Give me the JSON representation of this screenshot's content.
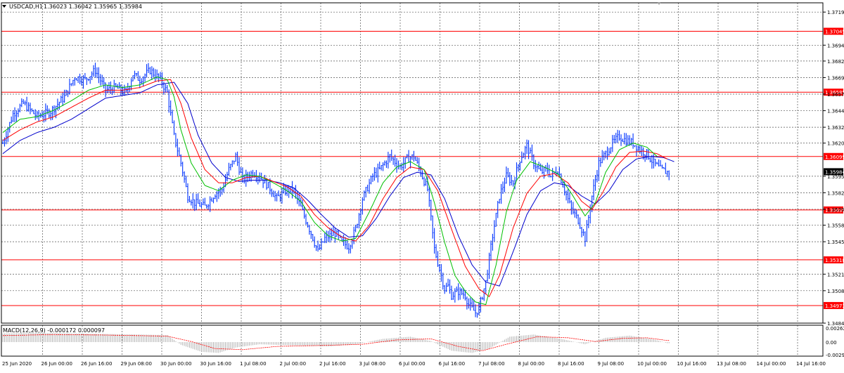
{
  "header": {
    "symbol_label": "USDCAD,H1",
    "ohlc_label": "1.36023 1.36042 1.35965 1.35984"
  },
  "indicator": {
    "label": "MACD(12,26,9) -0.000172 0.000097",
    "ticks": [
      "0.002626",
      "0.00",
      "-0.00298"
    ]
  },
  "colors": {
    "background": "#ffffff",
    "price_line": "#0033ff",
    "ma_fast": "#00c000",
    "ma_mid": "#ff0000",
    "ma_slow": "#0000cc",
    "level_line": "#ff0000",
    "level_label_bg": "#ff0000",
    "current_price_bg": "#000000",
    "grid": "#555555",
    "macd_hist": "#b4b4b4",
    "macd_signal": "#ff0000"
  },
  "chart_data": {
    "type": "line",
    "title": "USDCAD,H1",
    "y_ticks": [
      "1.37190",
      "1.36940",
      "1.36820",
      "1.36695",
      "1.36570",
      "1.36445",
      "1.36320",
      "1.36200",
      "1.35950",
      "1.35825",
      "1.35700",
      "1.35580",
      "1.35455",
      "1.35210",
      "1.35085",
      "1.34840"
    ],
    "ylim": [
      1.3484,
      1.3726
    ],
    "x_tick_labels": [
      "25 Jun 2020",
      "26 Jun 00:00",
      "26 Jun 16:00",
      "29 Jun 08:00",
      "30 Jun 00:00",
      "30 Jun 16:00",
      "1 Jul 08:00",
      "2 Jul 00:00",
      "2 Jul 16:00",
      "3 Jul 08:00",
      "6 Jul 00:00",
      "6 Jul 16:00",
      "7 Jul 08:00",
      "8 Jul 00:00",
      "8 Jul 16:00",
      "9 Jul 08:00",
      "10 Jul 00:00",
      "10 Jul 16:00",
      "13 Jul 08:00",
      "14 Jul 00:00",
      "14 Jul 16:00"
    ],
    "horizontal_levels": [
      "1.37045",
      "1.36585",
      "1.36099",
      "1.35695",
      "1.35318",
      "1.34973"
    ],
    "current_price": "1.35984",
    "price_anchors": [
      [
        0,
        1.362
      ],
      [
        6,
        1.3642
      ],
      [
        12,
        1.365
      ],
      [
        20,
        1.364
      ],
      [
        28,
        1.3644
      ],
      [
        36,
        1.3655
      ],
      [
        42,
        1.367
      ],
      [
        48,
        1.3668
      ],
      [
        54,
        1.3675
      ],
      [
        60,
        1.366
      ],
      [
        66,
        1.3662
      ],
      [
        72,
        1.3658
      ],
      [
        76,
        1.3672
      ],
      [
        80,
        1.3668
      ],
      [
        86,
        1.3675
      ],
      [
        92,
        1.3668
      ],
      [
        96,
        1.3658
      ],
      [
        100,
        1.3625
      ],
      [
        104,
        1.3605
      ],
      [
        108,
        1.358
      ],
      [
        112,
        1.3575
      ],
      [
        118,
        1.3572
      ],
      [
        124,
        1.3582
      ],
      [
        128,
        1.3585
      ],
      [
        132,
        1.36
      ],
      [
        136,
        1.361
      ],
      [
        140,
        1.3592
      ],
      [
        146,
        1.3598
      ],
      [
        150,
        1.3595
      ],
      [
        156,
        1.3586
      ],
      [
        160,
        1.3578
      ],
      [
        166,
        1.3585
      ],
      [
        170,
        1.3584
      ],
      [
        176,
        1.3565
      ],
      [
        180,
        1.3552
      ],
      [
        184,
        1.3538
      ],
      [
        188,
        1.3548
      ],
      [
        194,
        1.3552
      ],
      [
        198,
        1.3545
      ],
      [
        202,
        1.3542
      ],
      [
        206,
        1.3555
      ],
      [
        210,
        1.3578
      ],
      [
        216,
        1.3595
      ],
      [
        220,
        1.36
      ],
      [
        226,
        1.361
      ],
      [
        232,
        1.3602
      ],
      [
        236,
        1.3608
      ],
      [
        240,
        1.361
      ],
      [
        244,
        1.3598
      ],
      [
        248,
        1.3585
      ],
      [
        252,
        1.354
      ],
      [
        256,
        1.352
      ],
      [
        258,
        1.351
      ],
      [
        260,
        1.3512
      ],
      [
        262,
        1.3505
      ],
      [
        266,
        1.3508
      ],
      [
        270,
        1.3505
      ],
      [
        272,
        1.3498
      ],
      [
        276,
        1.3492
      ],
      [
        278,
        1.3495
      ],
      [
        282,
        1.3515
      ],
      [
        286,
        1.355
      ],
      [
        290,
        1.358
      ],
      [
        294,
        1.3595
      ],
      [
        298,
        1.359
      ],
      [
        302,
        1.3608
      ],
      [
        306,
        1.3618
      ],
      [
        310,
        1.3605
      ],
      [
        314,
        1.3598
      ],
      [
        318,
        1.36
      ],
      [
        320,
        1.3595
      ],
      [
        324,
        1.36
      ],
      [
        328,
        1.3585
      ],
      [
        332,
        1.357
      ],
      [
        336,
        1.3562
      ],
      [
        340,
        1.3548
      ],
      [
        344,
        1.358
      ],
      [
        348,
        1.3605
      ],
      [
        352,
        1.3612
      ],
      [
        356,
        1.362
      ],
      [
        360,
        1.3625
      ],
      [
        364,
        1.3622
      ],
      [
        368,
        1.362
      ],
      [
        372,
        1.3615
      ],
      [
        376,
        1.3612
      ],
      [
        380,
        1.3605
      ],
      [
        384,
        1.36
      ],
      [
        388,
        1.3598
      ]
    ],
    "ma_fast_anchors": [
      [
        0,
        1.3628
      ],
      [
        10,
        1.3638
      ],
      [
        20,
        1.364
      ],
      [
        30,
        1.3645
      ],
      [
        40,
        1.3652
      ],
      [
        50,
        1.366
      ],
      [
        60,
        1.3664
      ],
      [
        70,
        1.3662
      ],
      [
        80,
        1.3664
      ],
      [
        90,
        1.367
      ],
      [
        96,
        1.3668
      ],
      [
        100,
        1.3655
      ],
      [
        104,
        1.363
      ],
      [
        110,
        1.3605
      ],
      [
        118,
        1.3588
      ],
      [
        126,
        1.3584
      ],
      [
        134,
        1.3592
      ],
      [
        142,
        1.3596
      ],
      [
        150,
        1.3595
      ],
      [
        158,
        1.359
      ],
      [
        166,
        1.3584
      ],
      [
        174,
        1.3576
      ],
      [
        182,
        1.356
      ],
      [
        190,
        1.355
      ],
      [
        198,
        1.3546
      ],
      [
        206,
        1.3548
      ],
      [
        214,
        1.3568
      ],
      [
        222,
        1.359
      ],
      [
        230,
        1.3602
      ],
      [
        238,
        1.3606
      ],
      [
        246,
        1.36
      ],
      [
        252,
        1.3575
      ],
      [
        258,
        1.3545
      ],
      [
        264,
        1.352
      ],
      [
        270,
        1.3508
      ],
      [
        276,
        1.35
      ],
      [
        282,
        1.3498
      ],
      [
        288,
        1.3528
      ],
      [
        294,
        1.3568
      ],
      [
        300,
        1.3592
      ],
      [
        308,
        1.3606
      ],
      [
        316,
        1.3602
      ],
      [
        324,
        1.3597
      ],
      [
        332,
        1.3582
      ],
      [
        340,
        1.3565
      ],
      [
        346,
        1.3575
      ],
      [
        352,
        1.3598
      ],
      [
        360,
        1.3615
      ],
      [
        368,
        1.362
      ],
      [
        376,
        1.3617
      ],
      [
        382,
        1.361
      ]
    ],
    "ma_mid_anchors": [
      [
        0,
        1.3622
      ],
      [
        10,
        1.363
      ],
      [
        20,
        1.3636
      ],
      [
        30,
        1.364
      ],
      [
        40,
        1.3647
      ],
      [
        50,
        1.3654
      ],
      [
        60,
        1.366
      ],
      [
        70,
        1.366
      ],
      [
        80,
        1.3662
      ],
      [
        90,
        1.3667
      ],
      [
        98,
        1.3668
      ],
      [
        104,
        1.365
      ],
      [
        110,
        1.3624
      ],
      [
        118,
        1.36
      ],
      [
        126,
        1.359
      ],
      [
        134,
        1.359
      ],
      [
        142,
        1.3594
      ],
      [
        150,
        1.3595
      ],
      [
        158,
        1.3591
      ],
      [
        166,
        1.3587
      ],
      [
        174,
        1.358
      ],
      [
        182,
        1.3566
      ],
      [
        190,
        1.3556
      ],
      [
        198,
        1.3549
      ],
      [
        206,
        1.3546
      ],
      [
        214,
        1.3558
      ],
      [
        222,
        1.3578
      ],
      [
        230,
        1.3594
      ],
      [
        238,
        1.3602
      ],
      [
        246,
        1.36
      ],
      [
        254,
        1.3584
      ],
      [
        262,
        1.3555
      ],
      [
        270,
        1.3527
      ],
      [
        278,
        1.351
      ],
      [
        284,
        1.3504
      ],
      [
        290,
        1.352
      ],
      [
        298,
        1.3556
      ],
      [
        306,
        1.3582
      ],
      [
        314,
        1.3595
      ],
      [
        322,
        1.3597
      ],
      [
        330,
        1.359
      ],
      [
        338,
        1.3576
      ],
      [
        344,
        1.357
      ],
      [
        350,
        1.3582
      ],
      [
        358,
        1.3602
      ],
      [
        366,
        1.3613
      ],
      [
        374,
        1.3614
      ],
      [
        382,
        1.3612
      ],
      [
        388,
        1.3608
      ]
    ],
    "ma_slow_anchors": [
      [
        0,
        1.3612
      ],
      [
        10,
        1.3622
      ],
      [
        20,
        1.3628
      ],
      [
        30,
        1.3632
      ],
      [
        40,
        1.3638
      ],
      [
        50,
        1.3646
      ],
      [
        60,
        1.3654
      ],
      [
        70,
        1.3656
      ],
      [
        80,
        1.3658
      ],
      [
        90,
        1.3664
      ],
      [
        100,
        1.3666
      ],
      [
        108,
        1.365
      ],
      [
        114,
        1.3626
      ],
      [
        122,
        1.3605
      ],
      [
        130,
        1.3594
      ],
      [
        138,
        1.3591
      ],
      [
        146,
        1.3592
      ],
      [
        154,
        1.3592
      ],
      [
        162,
        1.359
      ],
      [
        170,
        1.3586
      ],
      [
        178,
        1.3577
      ],
      [
        186,
        1.3566
      ],
      [
        194,
        1.3556
      ],
      [
        202,
        1.3549
      ],
      [
        210,
        1.355
      ],
      [
        218,
        1.3563
      ],
      [
        226,
        1.358
      ],
      [
        234,
        1.3594
      ],
      [
        242,
        1.3598
      ],
      [
        250,
        1.3596
      ],
      [
        258,
        1.3578
      ],
      [
        266,
        1.355
      ],
      [
        274,
        1.3528
      ],
      [
        282,
        1.3515
      ],
      [
        290,
        1.3512
      ],
      [
        298,
        1.3538
      ],
      [
        306,
        1.3566
      ],
      [
        314,
        1.3584
      ],
      [
        322,
        1.359
      ],
      [
        330,
        1.3588
      ],
      [
        338,
        1.358
      ],
      [
        346,
        1.3574
      ],
      [
        354,
        1.3584
      ],
      [
        362,
        1.36
      ],
      [
        370,
        1.3608
      ],
      [
        378,
        1.361
      ],
      [
        386,
        1.3609
      ],
      [
        392,
        1.3606
      ]
    ],
    "macd_hist_anchors": [
      [
        0,
        0.0016
      ],
      [
        20,
        0.0017
      ],
      [
        40,
        0.0016
      ],
      [
        60,
        0.0015
      ],
      [
        80,
        0.0014
      ],
      [
        96,
        0.0013
      ],
      [
        104,
        -0.0005
      ],
      [
        116,
        -0.0018
      ],
      [
        126,
        -0.002
      ],
      [
        136,
        -0.001
      ],
      [
        150,
        -0.0004
      ],
      [
        170,
        -0.0006
      ],
      [
        190,
        -0.0008
      ],
      [
        206,
        -0.0004
      ],
      [
        222,
        0.0006
      ],
      [
        238,
        0.001
      ],
      [
        250,
        0.0002
      ],
      [
        262,
        -0.0016
      ],
      [
        274,
        -0.002
      ],
      [
        284,
        -0.0012
      ],
      [
        296,
        0.001
      ],
      [
        310,
        0.0014
      ],
      [
        326,
        0.0006
      ],
      [
        340,
        -0.0004
      ],
      [
        352,
        0.0008
      ],
      [
        366,
        0.0012
      ],
      [
        380,
        0.0005
      ],
      [
        388,
        -0.0002
      ]
    ],
    "macd_signal_anchors": [
      [
        0,
        0.0012
      ],
      [
        30,
        0.0014
      ],
      [
        60,
        0.0013
      ],
      [
        96,
        0.0011
      ],
      [
        110,
        0.0001
      ],
      [
        124,
        -0.0012
      ],
      [
        140,
        -0.0014
      ],
      [
        160,
        -0.0008
      ],
      [
        190,
        -0.0006
      ],
      [
        210,
        -0.0004
      ],
      [
        230,
        0.0004
      ],
      [
        250,
        0.0006
      ],
      [
        266,
        -0.0008
      ],
      [
        280,
        -0.0016
      ],
      [
        294,
        -0.0004
      ],
      [
        312,
        0.001
      ],
      [
        330,
        0.0008
      ],
      [
        346,
        0.0001
      ],
      [
        362,
        0.0007
      ],
      [
        376,
        0.0008
      ],
      [
        388,
        0.0003
      ]
    ]
  }
}
